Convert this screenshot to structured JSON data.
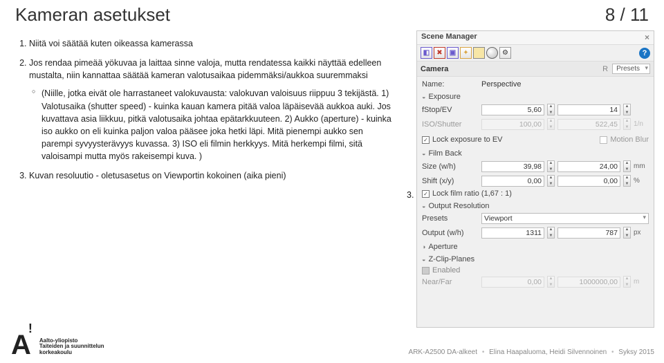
{
  "page": {
    "title": "Kameran asetukset",
    "number": "8 / 11"
  },
  "list": {
    "item1": "Niitä voi säätää kuten oikeassa kamerassa",
    "item2_lead": "Jos rendaa pimeää yökuvaa ja laittaa sinne valoja, mutta rendatessa kaikki näyttää edelleen mustalta, niin kannattaa säätää kameran valotusaikaa pidemmäksi/aukkoa suuremmaksi",
    "item2_sub": "(Niille, jotka eivät ole harrastaneet valokuvausta: valokuvan valoisuus riippuu 3 tekijästä. 1) Valotusaika (shutter speed) - kuinka kauan kamera pitää valoa läpäisevää aukkoa auki. Jos kuvattava asia liikkuu, pitkä valotusaika johtaa epätarkkuuteen. 2) Aukko (aperture) - kuinka iso aukko on eli kuinka paljon valoa pääsee joka hetki läpi. Mitä pienempi aukko sen parempi syvyysterävyys kuvassa. 3) ISO eli filmin herkkyys. Mitä herkempi filmi, sitä valoisampi mutta myös rakeisempi kuva. )",
    "item3": "Kuvan resoluutio - oletusasetus on Viewportin kokoinen (aika pieni)"
  },
  "marker3": "3.",
  "panel": {
    "title": "Scene Manager",
    "close": "×",
    "help": "?",
    "camera_label": "Camera",
    "camera_R": "R",
    "presets_label": "Presets",
    "name_label": "Name:",
    "name_value": "Perspective",
    "sections": {
      "exposure": "Exposure",
      "filmback": "Film Back",
      "output": "Output Resolution",
      "aperture": "Aperture",
      "zclip": "Z-Clip-Planes"
    },
    "exposure": {
      "fstop_lbl": "fStop/EV",
      "fstop_v1": "5,60",
      "fstop_v2": "14",
      "iso_lbl": "ISO/Shutter",
      "iso_v1": "100,00",
      "iso_v2": "522,45",
      "iso_unit": "1/n",
      "lock_exposure": "Lock exposure to EV",
      "motion_blur": "Motion Blur"
    },
    "filmback": {
      "size_lbl": "Size (w/h)",
      "size_v1": "39,98",
      "size_v2": "24,00",
      "size_unit": "mm",
      "shift_lbl": "Shift (x/y)",
      "shift_v1": "0,00",
      "shift_v2": "0,00",
      "shift_unit": "%",
      "lock_ratio": "Lock film ratio (1,67 : 1)"
    },
    "output": {
      "presets_lbl": "Presets",
      "presets_val": "Viewport",
      "out_lbl": "Output (w/h)",
      "out_v1": "1311",
      "out_v2": "787",
      "out_unit": "px"
    },
    "zclip": {
      "enabled": "Enabled",
      "near_lbl": "Near/Far",
      "near_v": "0,00",
      "far_v": "1000000,00",
      "unit": "m"
    }
  },
  "footer": {
    "logo_sub1": "Aalto-yliopisto",
    "logo_sub2": "Taiteiden ja suunnittelun",
    "logo_sub3": "korkeakoulu",
    "course": "ARK-A2500 DA-alkeet",
    "authors": "Elina Haapaluoma, Heidi Silvennoinen",
    "term": "Syksy 2015"
  }
}
